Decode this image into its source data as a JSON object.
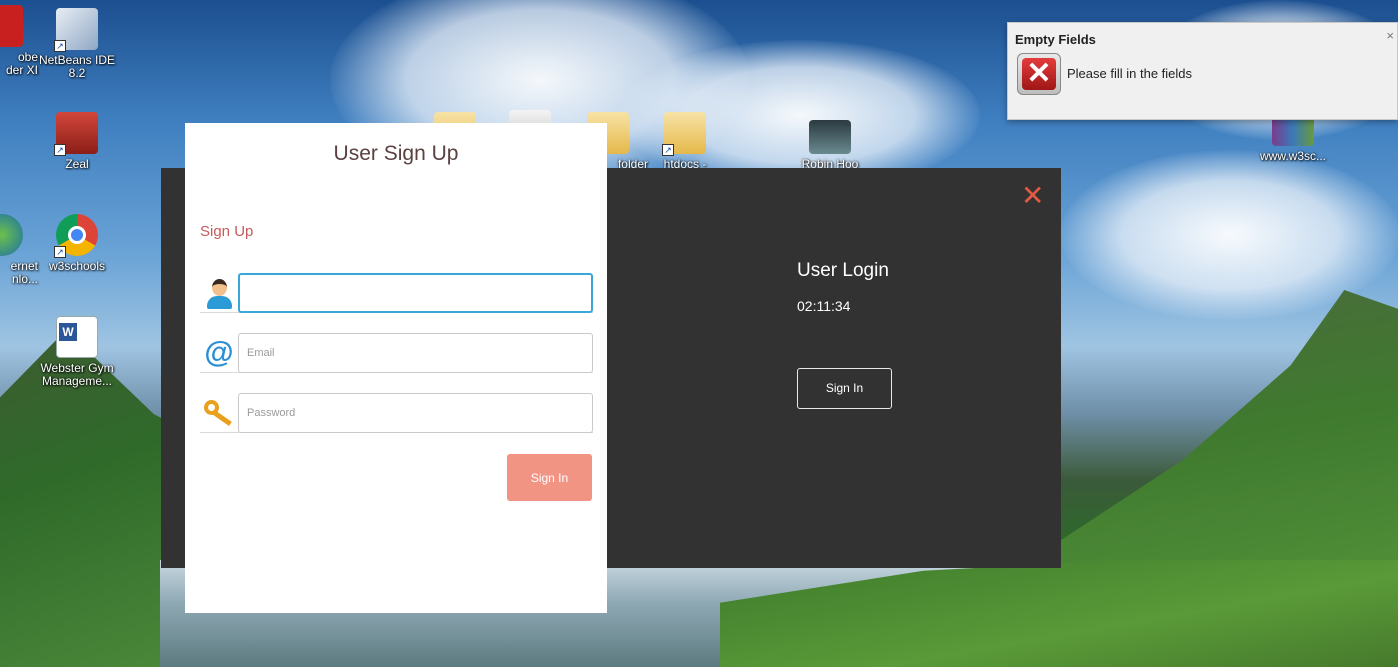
{
  "desktop": {
    "icons": [
      {
        "name": "adobe-reader-icon",
        "label_line1": "obe",
        "label_line2": "der XI"
      },
      {
        "name": "netbeans-icon",
        "label_line1": "NetBeans IDE",
        "label_line2": "8.2"
      },
      {
        "name": "zeal-icon",
        "label_line1": "Zeal",
        "label_line2": ""
      },
      {
        "name": "internet-download-icon",
        "label_line1": "ernet",
        "label_line2": "nlo..."
      },
      {
        "name": "w3schools-chrome-icon",
        "label_line1": "w3schools",
        "label_line2": ""
      },
      {
        "name": "webster-gym-doc-icon",
        "label_line1": "Webster Gym",
        "label_line2": "Manageme..."
      },
      {
        "name": "folder-icon",
        "label_line1": "folder",
        "label_line2": ""
      },
      {
        "name": "htdocs-icon",
        "label_line1": "htdocs -",
        "label_line2": ""
      },
      {
        "name": "robin-hood-video-icon",
        "label_line1": "Robin Hoo",
        "label_line2": ""
      },
      {
        "name": "www-w3sc-archive-icon",
        "label_line1": "www.w3sc...",
        "label_line2": ""
      }
    ]
  },
  "toast": {
    "title": "Empty Fields",
    "close": "×",
    "message": "Please fill in the fields",
    "icon": "error-x-icon"
  },
  "login_panel": {
    "close": "✕",
    "title": "User Login",
    "clock": "02:11:34",
    "signin_label": "Sign In",
    "accent": "#e35a43"
  },
  "signup_card": {
    "title": "User Sign Up",
    "section_label": "Sign Up",
    "username": {
      "value": "",
      "placeholder": "",
      "icon": "user-avatar-icon"
    },
    "email": {
      "value": "",
      "placeholder": "Email",
      "icon": "at-sign-icon"
    },
    "password": {
      "value": "",
      "placeholder": "Password",
      "icon": "key-icon"
    },
    "signin_label": "Sign In",
    "button_color": "#f29484"
  }
}
